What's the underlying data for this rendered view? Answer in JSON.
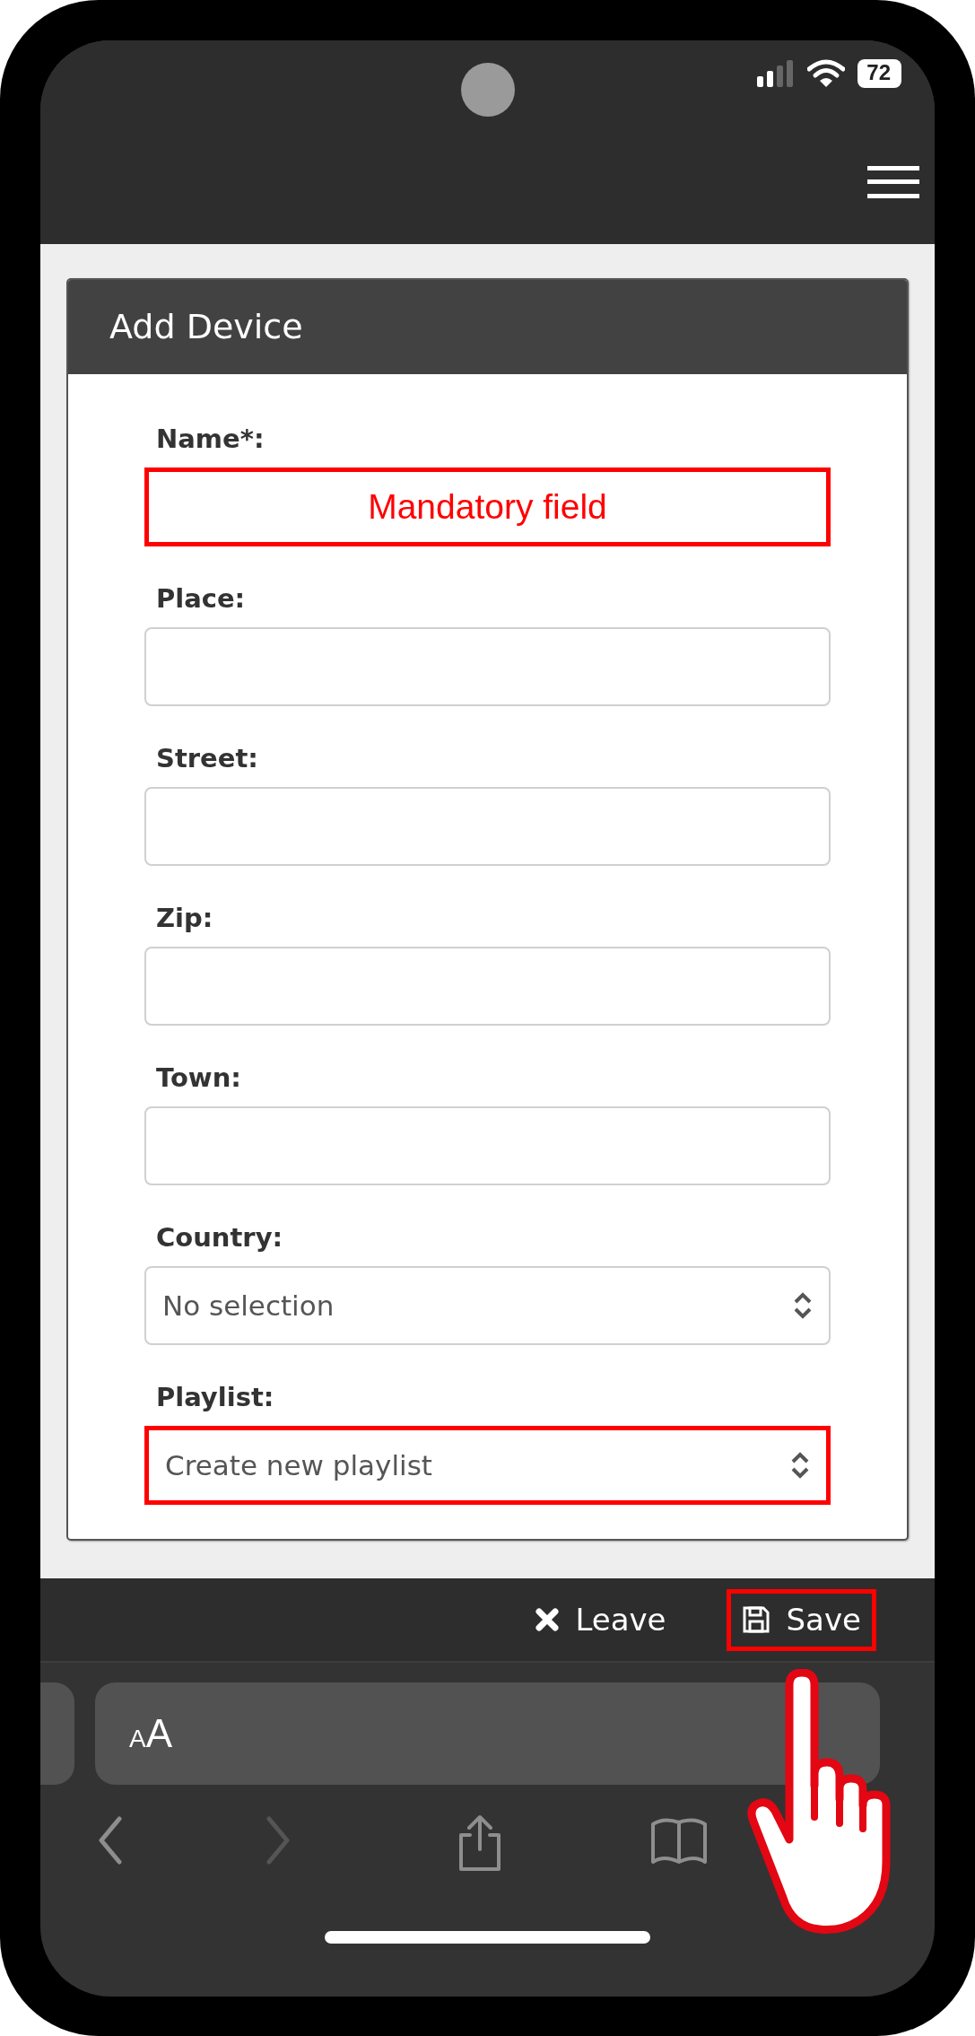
{
  "status_bar": {
    "battery": "72"
  },
  "card": {
    "title": "Add Device",
    "fields": [
      {
        "label": "Name*:",
        "kind": "text",
        "annotation": "Mandatory field",
        "highlighted": true
      },
      {
        "label": "Place:",
        "kind": "text",
        "highlighted": false
      },
      {
        "label": "Street:",
        "kind": "text",
        "highlighted": false
      },
      {
        "label": "Zip:",
        "kind": "text",
        "highlighted": false
      },
      {
        "label": "Town:",
        "kind": "text",
        "highlighted": false
      },
      {
        "label": "Country:",
        "kind": "select",
        "value": "No selection",
        "highlighted": false
      },
      {
        "label": "Playlist:",
        "kind": "select",
        "value": "Create new playlist",
        "highlighted": true
      }
    ]
  },
  "actions": [
    {
      "kind": "leave",
      "label": "Leave",
      "highlighted": false
    },
    {
      "kind": "save",
      "label": "Save",
      "highlighted": true
    }
  ],
  "browser": {
    "text_size": {
      "small_letter": "A",
      "large_letter": "A"
    },
    "nav": [
      {
        "kind": "back",
        "disabled": false
      },
      {
        "kind": "forward",
        "disabled": true
      },
      {
        "kind": "share",
        "disabled": false
      },
      {
        "kind": "bookmarks",
        "disabled": false
      }
    ]
  }
}
